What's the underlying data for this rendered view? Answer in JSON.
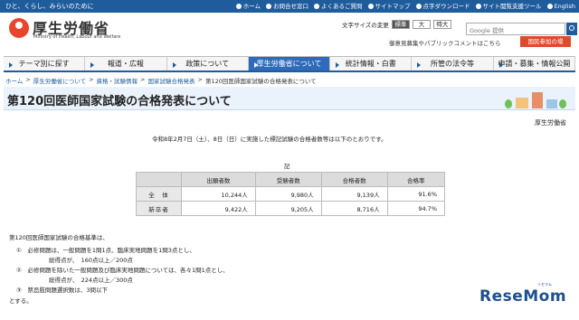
{
  "topbar": {
    "tagline": "ひと、くらし、みらいのために",
    "links": [
      "ホーム",
      "お問合せ窓口",
      "よくあるご質問",
      "サイトマップ",
      "点字ダウンロード",
      "サイト閲覧支援ツール",
      "English"
    ]
  },
  "header": {
    "logo_text": "厚生労働省",
    "logo_sub": "Ministry of Health, Labour and Welfare",
    "fontsize_label": "文字サイズの変更",
    "fontsize_options": [
      "標準",
      "大",
      "特大"
    ],
    "search_placeholder": "Google 提供",
    "opinion_link": "御意見募集やパブリックコメントはこちら",
    "join_button": "国民参加の場"
  },
  "nav": {
    "tabs": [
      "テーマ別に探す",
      "報道・広報",
      "政策について",
      "厚生労働省について",
      "統計情報・白書",
      "所管の法令等",
      "申請・募集・情報公開"
    ],
    "active_index": 3
  },
  "breadcrumb": [
    "ホーム",
    "厚生労働省について",
    "資格・試験情報",
    "国家試験合格発表",
    "第120回医師国家試験の合格発表について"
  ],
  "page": {
    "title": "第120回医師国家試験の合格発表について",
    "author": "厚生労働省",
    "lead": "令和8年2月7日（土）、8日（日）に実施した標記試験の合格者数等は以下のとおりです。",
    "ki": "記"
  },
  "results": {
    "headers": [
      "",
      "出願者数",
      "受験者数",
      "合格者数",
      "合格率"
    ],
    "rows": [
      {
        "label": "全　体",
        "applicants": "10,244人",
        "examinees": "9,980人",
        "passed": "9,139人",
        "rate": "91.6%"
      },
      {
        "label": "新卒者",
        "applicants": "9,422人",
        "examinees": "9,205人",
        "passed": "8,716人",
        "rate": "94.7%"
      }
    ]
  },
  "criteria": {
    "title": "第120回医師国家試験の合格基準は、",
    "items": [
      "①　必修問題は、一般問題を1問1点、臨床実地問題を1問3点とし、",
      "総得点が、　160点以上／200点",
      "②　必修問題を除いた一般問題及び臨床実地問題については、各々1問1点とし、",
      "総得点が、　224点以上／300点",
      "③　禁忌肢問題選択数は、3問以下"
    ],
    "closing": "とする。"
  },
  "watermark": {
    "main": "ReseMom",
    "sub": "リセマム"
  }
}
